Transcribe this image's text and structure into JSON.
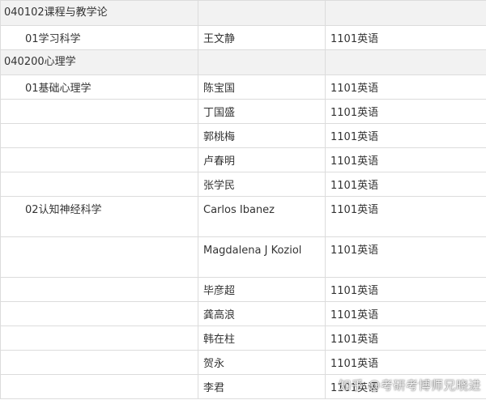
{
  "sections": [
    {
      "code": "040102课程与教学论",
      "rows": [
        {
          "direction": "01学习科学",
          "teacher": "王文静",
          "exam": "1101英语"
        }
      ]
    },
    {
      "code": "040200心理学",
      "rows": [
        {
          "direction": "01基础心理学",
          "teacher": "陈宝国",
          "exam": "1101英语"
        },
        {
          "direction": "",
          "teacher": "丁国盛",
          "exam": "1101英语"
        },
        {
          "direction": "",
          "teacher": "郭桃梅",
          "exam": "1101英语"
        },
        {
          "direction": "",
          "teacher": "卢春明",
          "exam": "1101英语"
        },
        {
          "direction": "",
          "teacher": "张学民",
          "exam": "1101英语"
        },
        {
          "direction": "02认知神经科学",
          "teacher": "Carlos Ibanez",
          "exam": "1101英语"
        },
        {
          "direction": "",
          "teacher": "Magdalena J Koziol",
          "exam": "1101英语"
        },
        {
          "direction": "",
          "teacher": "毕彦超",
          "exam": "1101英语"
        },
        {
          "direction": "",
          "teacher": "龚高浪",
          "exam": "1101英语"
        },
        {
          "direction": "",
          "teacher": "韩在柱",
          "exam": "1101英语"
        },
        {
          "direction": "",
          "teacher": "贺永",
          "exam": "1101英语"
        },
        {
          "direction": "",
          "teacher": "李君",
          "exam": "1101英语"
        }
      ]
    }
  ],
  "watermark": "知乎 @考研考博师兄晓进"
}
